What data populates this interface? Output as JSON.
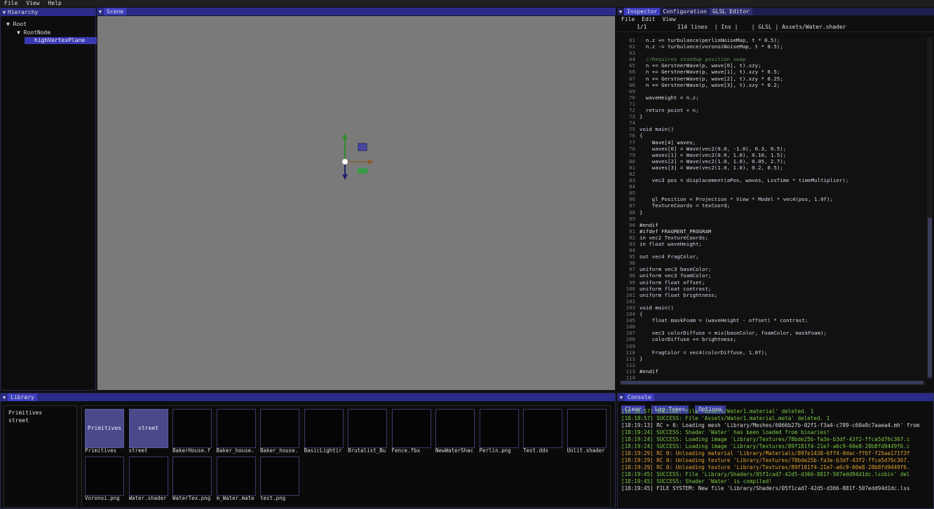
{
  "menubar": [
    "File",
    "View",
    "Help"
  ],
  "hierarchy": {
    "title": "Hierarchy",
    "items": [
      "Root",
      "RootNode",
      "highVertexPlane"
    ]
  },
  "scene": {
    "title": "Scene"
  },
  "inspector": {
    "tabs": [
      "Inspector",
      "Configuration",
      "GLSL Editor"
    ],
    "menu": [
      "File",
      "Edit",
      "View"
    ],
    "status": "1/1         114 lines  | Ins |    | GLSL | Assets/Water.shader"
  },
  "code": [
    [
      "61",
      "  n.z += turbulance(perlinNoiseMap, t * 0.5);"
    ],
    [
      "62",
      "  n.z -= turbulance(voronoiNoiseMap, t * 0.5);"
    ],
    [
      "63",
      "  "
    ],
    [
      "64",
      "  //Requires standup position swap"
    ],
    [
      "65",
      "  n += GerstnerWave(p, wave[0], t).xzy;"
    ],
    [
      "66",
      "  n += GerstnerWave(p, wave[1], t).xzy * 0.5;"
    ],
    [
      "67",
      "  n += GerstnerWave(p, wave[2], t).xzy * 0.25;"
    ],
    [
      "68",
      "  n += GerstnerWave(p, wave[3], t).xzy * 0.2;"
    ],
    [
      "69",
      "  "
    ],
    [
      "70",
      "  waveHeight = n.z;"
    ],
    [
      "71",
      "  "
    ],
    [
      "72",
      "  return point + n;"
    ],
    [
      "73",
      "}"
    ],
    [
      "74",
      ""
    ],
    [
      "75",
      "void main()"
    ],
    [
      "76",
      "{"
    ],
    [
      "77",
      "    Wave[4] waves;"
    ],
    [
      "78",
      "    waves[0] = Wave(vec2(0.0, -1.0), 0.3, 0.5);"
    ],
    [
      "79",
      "    waves[1] = Wave(vec2(0.0, 1.0), 0.10, 1.5);"
    ],
    [
      "80",
      "    waves[2] = Wave(vec2(1.0, 1.0), 0.05, 2.7);"
    ],
    [
      "81",
      "    waves[3] = Wave(vec2(1.0, 1.0), 0.2, 0.5);"
    ],
    [
      "82",
      ""
    ],
    [
      "83",
      "    vec3 pos = displacement(aPos, waves, LssTime * timeMultiplier);"
    ],
    [
      "84",
      ""
    ],
    [
      "85",
      ""
    ],
    [
      "86",
      "    gl_Position = Projection * View * Model * vec4(pos, 1.0f);"
    ],
    [
      "87",
      "    TextureCoords = texCoord;"
    ],
    [
      "88",
      "}"
    ],
    [
      "89",
      ""
    ],
    [
      "90",
      "#endif"
    ],
    [
      "91",
      "#ifdef FRAGMENT_PROGRAM"
    ],
    [
      "92",
      "in vec2 TextureCoords;"
    ],
    [
      "93",
      "in float waveHeight;"
    ],
    [
      "94",
      ""
    ],
    [
      "95",
      "out vec4 FragColor;"
    ],
    [
      "96",
      ""
    ],
    [
      "97",
      "uniform vec3 baseColor;"
    ],
    [
      "98",
      "uniform vec3 foamColor;"
    ],
    [
      "99",
      "uniform float offset;"
    ],
    [
      "100",
      "uniform float contrast;"
    ],
    [
      "101",
      "uniform float brightness;"
    ],
    [
      "102",
      ""
    ],
    [
      "103",
      "void main()"
    ],
    [
      "104",
      "{"
    ],
    [
      "105",
      "    float maskFoam = (waveHeight - offset) * contrast;"
    ],
    [
      "106",
      ""
    ],
    [
      "107",
      "    vec3 colorDiffuse = mix(baseColor, foamColor, maskFoam);"
    ],
    [
      "108",
      "    colorDiffuse += brightness;"
    ],
    [
      "109",
      ""
    ],
    [
      "110",
      "    FragColor = vec4(colorDiffuse, 1.0f);"
    ],
    [
      "111",
      "}"
    ],
    [
      "112",
      ""
    ],
    [
      "113",
      "#endif"
    ],
    [
      "114",
      ""
    ]
  ],
  "library": {
    "title": "Library",
    "folders": [
      "Primitives",
      "street"
    ],
    "row1": [
      "Primitives",
      "street",
      "BakerHouse.f",
      "Baker_house.",
      "Baker_house.",
      "BasicLightir",
      "Brutalist_Bu",
      "Fence.fbx",
      "NewWaterShac",
      "Perlin.png",
      "Test.dds",
      "Unlit.shader"
    ],
    "row2": [
      "Voronoi.png",
      "Water.shader",
      "WaterTex.png",
      "m_Water.mate",
      "test.png"
    ]
  },
  "console": {
    "title": "Console",
    "buttons": [
      "Clear",
      "Log Types",
      "Options"
    ],
    "lines": [
      [
        "ok",
        "[18:18:57] SUCCESS: File 'Assets/Water1.material' deleted. 1"
      ],
      [
        "ok",
        "[18:18:57] SUCCESS: File 'Assets/Water1.material.meta' deleted. 1"
      ],
      [
        "plain",
        "[18:19:13] RC > 0: Loading mesh 'Library/Meshes/6066b27b-02f1-f3a4-c789-c60a9c7aaea4.mh' from"
      ],
      [
        "ok",
        "[18:19:24] SUCCESS: Shader 'Water' has been loaded from binaries!"
      ],
      [
        "ok",
        "[18:19:24] SUCCESS: Loading image 'Library/Textures/78bde25b-fa3e-b3df-43f2-ffca5d76c367.c"
      ],
      [
        "ok",
        "[18:19:24] SUCCESS: Loading image 'Library/Textures/89f181f4-21e7-a6c9-60e8-28b8fd9449f6.c"
      ],
      [
        "warn",
        "[18:19:29] RC 0: Unloading material 'Library/Materials/897e1438-6ff4-0dac-ff6f-f25ae171f3f"
      ],
      [
        "warn",
        "[18:19:29] RC 0: Unloading texture 'Library/Textures/78bde25b-fa3e-b3df-43f2-ffca5d76c367."
      ],
      [
        "warn",
        "[18:19:29] RC 0: Unloading texture 'Library/Textures/89f181f4-21e7-a6c9-60e8-28b8fd9449f6."
      ],
      [
        "ok",
        "[18:19:45] SUCCESS: File 'Library/Shaders/05f1cad7-42d5-d366-881f-507edd94d1dc.lssbin' del"
      ],
      [
        "ok",
        "[18:19:45] SUCCESS: Shader 'Water' is compiled!"
      ],
      [
        "plain",
        "[18:19:45] FILE SYSTEM: New file 'Library/Shaders/05f1cad7-42d5-d366-881f-507edd94d1dc.lss"
      ]
    ]
  },
  "colors": {
    "accent": "#2b2b8a",
    "selection": "#3a3ab0",
    "scene": "#7a7a7a"
  }
}
